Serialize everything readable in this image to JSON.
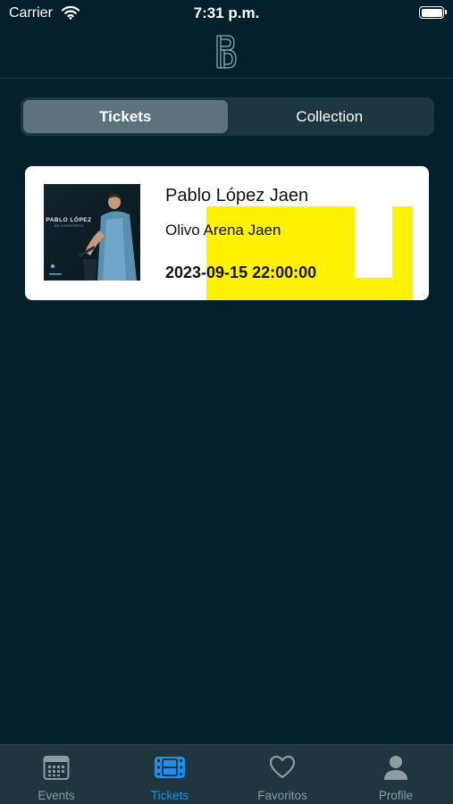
{
  "status_bar": {
    "carrier": "Carrier",
    "time": "7:31 p.m."
  },
  "header": {
    "logo_icon": "brand-logo-icon"
  },
  "segmented": {
    "tabs": [
      {
        "label": "Tickets",
        "selected": true
      },
      {
        "label": "Collection",
        "selected": false
      }
    ]
  },
  "tickets": [
    {
      "title": "Pablo López Jaen",
      "venue": "Olivo Arena Jaen",
      "datetime": "2023-09-15 22:00:00",
      "poster": {
        "artist_text": "PABLO LÓPEZ",
        "subtitle_text": "EN CONCIERTO"
      }
    }
  ],
  "tab_bar": {
    "items": [
      {
        "label": "Events",
        "icon": "calendar-icon",
        "active": false
      },
      {
        "label": "Tickets",
        "icon": "ticket-film-icon",
        "active": true
      },
      {
        "label": "Favoritos",
        "icon": "heart-icon",
        "active": false
      },
      {
        "label": "Profile",
        "icon": "person-icon",
        "active": false
      }
    ]
  },
  "colors": {
    "background": "#03202c",
    "accent": "#1f8ef1",
    "ticket_highlight": "#fff200",
    "card": "#ffffff"
  }
}
